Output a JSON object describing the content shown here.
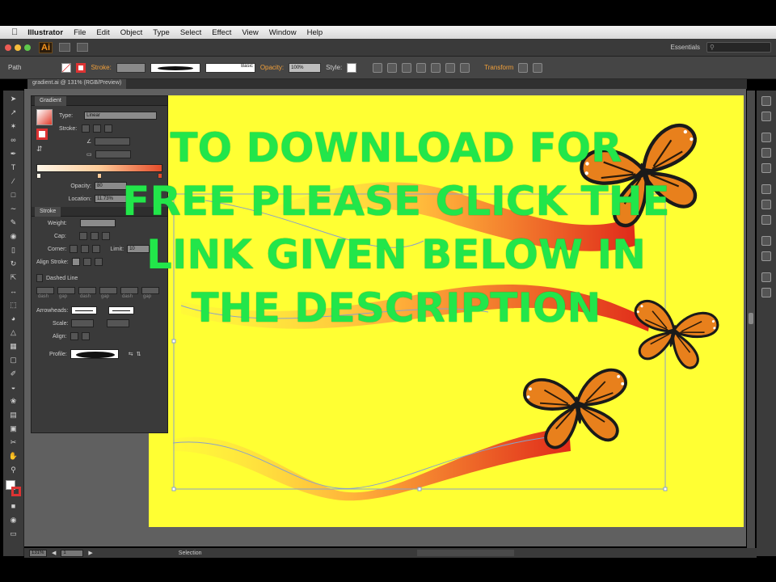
{
  "menubar": {
    "apple": "",
    "items": [
      "Illustrator",
      "File",
      "Edit",
      "Object",
      "Type",
      "Select",
      "Effect",
      "View",
      "Window",
      "Help"
    ]
  },
  "appbar": {
    "logo": "Ai",
    "workspace": "Essentials",
    "search_placeholder": ""
  },
  "controlbar": {
    "selection_type": "Path",
    "stroke_label": "Stroke:",
    "brush_label": "Basic",
    "opacity_label": "Opacity:",
    "opacity_value": "100%",
    "style_label": "Style:",
    "transform_label": "Transform"
  },
  "document": {
    "tab_title": "gradient.ai @ 131% (RGB/Preview)"
  },
  "gradient_panel": {
    "title": "Gradient",
    "type_label": "Type:",
    "type_value": "Linear",
    "stroke_label": "Stroke:",
    "opacity_label": "Opacity:",
    "opacity_value": "80",
    "location_label": "Location:",
    "location_value": "11.73%"
  },
  "stroke_panel": {
    "title": "Stroke",
    "weight_label": "Weight:",
    "cap_label": "Cap:",
    "corner_label": "Corner:",
    "limit_label": "Limit:",
    "limit_value": "10",
    "align_label": "Align Stroke:",
    "dashed_label": "Dashed Line",
    "dash_labels": [
      "dash",
      "gap",
      "dash",
      "gap",
      "dash",
      "gap"
    ],
    "arrowheads_label": "Arrowheads:",
    "scale_label": "Scale:",
    "align_label2": "Align:",
    "profile_label": "Profile:"
  },
  "statusbar": {
    "zoom": "131%",
    "page": "1",
    "tool": "Selection"
  },
  "overlay": {
    "lines": [
      "TO DOWNLOAD FOR",
      "FREE PLEASE CLICK THE",
      "LINK GIVEN BELOW IN",
      "THE DESCRIPTION"
    ]
  },
  "colors": {
    "artboard": "#ffff33",
    "overlay_text": "#22e64a",
    "ribbon_start": "#ffe14d",
    "ribbon_end": "#e02a1a",
    "butterfly_wing": "#e8801c"
  },
  "tool_icons": [
    "selection-arrow",
    "direct-selection",
    "magic-wand",
    "lasso",
    "pen",
    "type",
    "line",
    "rectangle",
    "paintbrush",
    "pencil",
    "blob-brush",
    "eraser",
    "rotate",
    "scale",
    "width",
    "free-transform",
    "shape-builder",
    "perspective",
    "mesh",
    "gradient",
    "eyedropper",
    "blend",
    "symbol-sprayer",
    "graph",
    "artboard",
    "slice",
    "hand",
    "zoom"
  ]
}
